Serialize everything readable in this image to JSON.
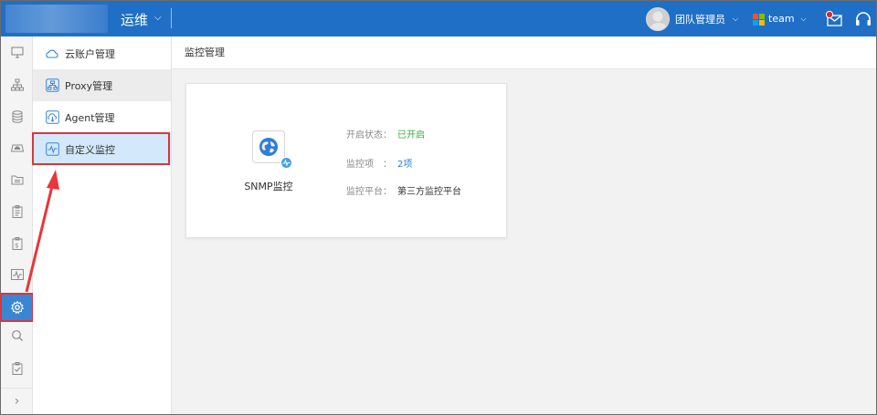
{
  "header": {
    "title": "运维",
    "user_name": "团队管理员",
    "team_name": "team"
  },
  "rail": {
    "icons": [
      "monitor-icon",
      "topology-icon",
      "database-icon",
      "cloud-host-icon",
      "folder-icon",
      "clipboard-icon",
      "report-icon",
      "pulse-icon",
      "gear-icon",
      "search-icon",
      "checklist-icon"
    ],
    "active": "gear-icon",
    "expand_glyph": "›"
  },
  "submenu": {
    "items": [
      {
        "label": "云账户管理",
        "icon": "cloud-icon"
      },
      {
        "label": "Proxy管理",
        "icon": "proxy-icon"
      },
      {
        "label": "Agent管理",
        "icon": "agent-icon"
      },
      {
        "label": "自定义监控",
        "icon": "custom-monitor-icon"
      }
    ]
  },
  "content": {
    "breadcrumb": "监控管理",
    "card": {
      "title": "SNMP监控",
      "status_label": "开启状态：",
      "status_value": "已开启",
      "items_label": "监控项　：",
      "items_value": "2项",
      "platform_label": "监控平台：",
      "platform_value": "第三方监控平台"
    }
  },
  "colors": {
    "topbar": "#1f6fc6",
    "active_rail": "#3a86d4",
    "highlight_border": "#d9363e",
    "status_green": "#3bab3b",
    "link_blue": "#2a7fd6"
  }
}
